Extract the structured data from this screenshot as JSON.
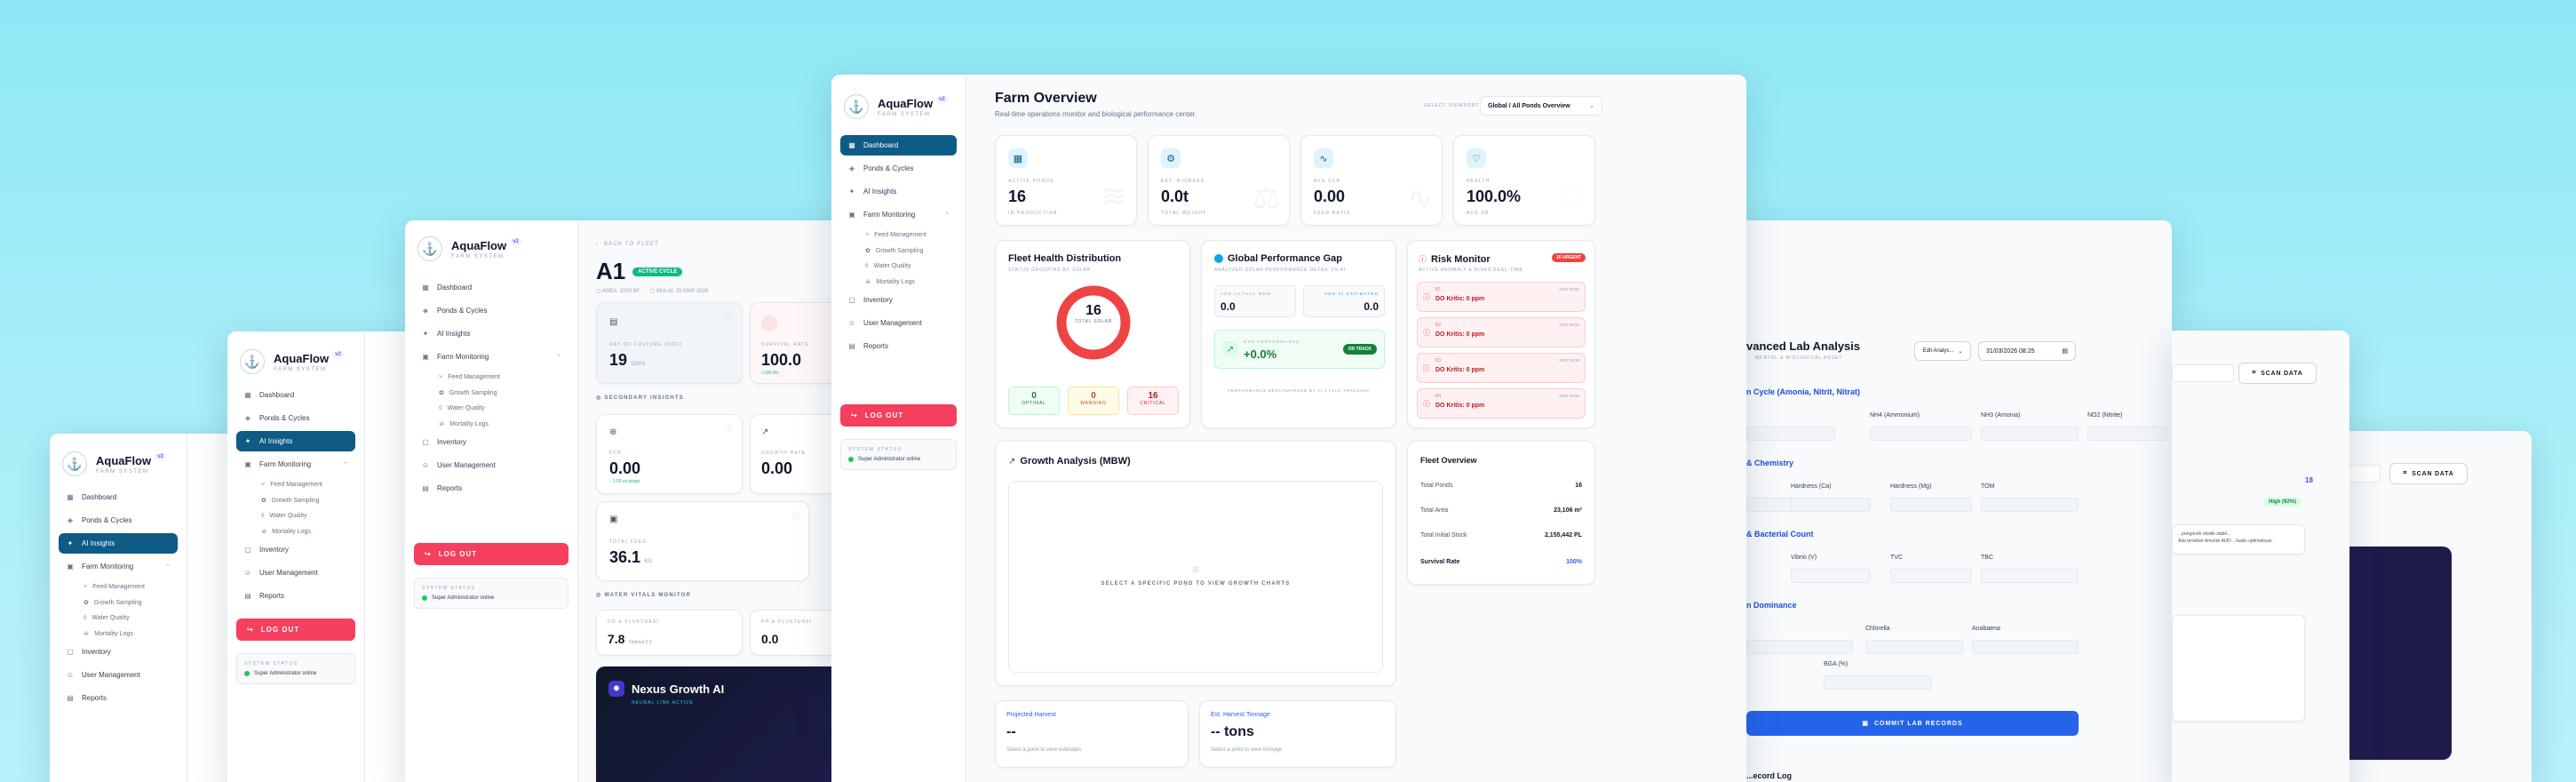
{
  "brand": {
    "name": "AquaFlow",
    "sub": "FARM SYSTEM",
    "ver": "v2"
  },
  "nav": {
    "dashboard": "Dashboard",
    "ponds": "Ponds & Cycles",
    "ai": "AI Insights",
    "farm": "Farm Monitoring",
    "feed": "Feed Management",
    "growth": "Growth Sampling",
    "water": "Water Quality",
    "mortality": "Mortality Logs",
    "inventory": "Inventory",
    "users": "User Management",
    "reports": "Reports"
  },
  "logout": "LOG OUT",
  "status": {
    "title": "SYSTEM STATUS",
    "value": "Super Administrator online"
  },
  "overview": {
    "title": "Farm Overview",
    "subtitle": "Real-time operations monitor and biological performance center.",
    "viewport_label": "SELECT VIEWPORT",
    "viewport_value": "Global / All Ponds Overview",
    "stats": [
      {
        "label": "ACTIVE PONDS",
        "value": "16",
        "note": "IN PRODUCTION"
      },
      {
        "label": "EST. BIOMASS",
        "value": "0.0t",
        "note": "TOTAL WEIGHT"
      },
      {
        "label": "AVG FCR",
        "value": "0.00",
        "note": "FEED RATIO"
      },
      {
        "label": "HEALTH",
        "value": "100.0%",
        "note": "AVG SR"
      }
    ],
    "fleet": {
      "title": "Fleet Health Distribution",
      "sub": "STATUS GROUPING BY SOLAR",
      "center": "16",
      "center_sub": "TOTAL SOLAR",
      "boxes": [
        {
          "v": "0",
          "l": "OPTIMAL"
        },
        {
          "v": "0",
          "l": "WARNING"
        },
        {
          "v": "16",
          "l": "CRITICAL"
        }
      ]
    },
    "gap": {
      "title": "Global Performance Gap",
      "sub": "ANALYZED SOLAR PERFORMANCE DETAIL VS AI",
      "actual_lbl": "ADG ACTUAL MBW",
      "actual": "0.0",
      "ai_lbl": "ADG AI ESTIMATED",
      "ai": "0.0",
      "perf_lbl": "GAP PERFORMANCE",
      "perf": "+0.0%",
      "badge": "ON TRACK",
      "foot": "PERFORMANCE BENCHMARKED BY AI CYCLE TRACKING"
    },
    "risk": {
      "title": "Risk Monitor",
      "sub": "ACTIVE ANOMALY & RISKS REAL-TIME",
      "badge": "16 URGENT",
      "rows": [
        {
          "id": "B1",
          "text": "DO Kritis: 0 ppm",
          "time": "JUST NOW"
        },
        {
          "id": "B2",
          "text": "DO Kritis: 0 ppm",
          "time": "JUST NOW"
        },
        {
          "id": "B3",
          "text": "DO Kritis: 0 ppm",
          "time": "JUST NOW"
        },
        {
          "id": "B4",
          "text": "DO Kritis: 0 ppm",
          "time": "JUST NOW"
        }
      ]
    },
    "growth": {
      "title": "Growth Analysis (MBW)",
      "placeholder": "SELECT A SPECIFIC POND TO VIEW GROWTH CHARTS"
    },
    "fleet_ov": {
      "title": "Fleet Overview",
      "rows": [
        {
          "k": "Total Ponds",
          "v": "16"
        },
        {
          "k": "Total Area",
          "v": "23,106 m²"
        },
        {
          "k": "Total Initial Stock",
          "v": "2,155,442 PL"
        },
        {
          "k": "Survival Rate",
          "v": "100%"
        }
      ]
    },
    "harvest": {
      "label": "Projected Harvest",
      "value": "--",
      "note": "Select a pond to view estimates"
    },
    "tonnage": {
      "label": "Est. Harvest Tonnage",
      "value": "-- tons",
      "note": "Select a pond to view tonnage"
    }
  },
  "pond": {
    "back": "BACK TO FLEET",
    "title": "A1",
    "badge": "ACTIVE CYCLE",
    "meta1": "AREA: 1000 M²",
    "meta2": "MULAI: 15 MAR 2026",
    "doc_lbl": "DAY OF CULTURE (DOC)",
    "doc": "19",
    "doc_unit": "DAYS",
    "surv_lbl": "SURVIVAL RATE",
    "surv": "100.0",
    "surv_note": "+100.0%",
    "secondary": "SECONDARY INSIGHTS",
    "fcr_lbl": "FCR",
    "fcr": "0.00",
    "fcr_note": "↑ 1.00 vs target",
    "growth_lbl": "GROWTH RATE",
    "growth": "0.00",
    "feed_lbl": "TOTAL FEED",
    "feed": "36.1",
    "feed_unit": "KG",
    "water": "WATER VITALS MONITOR",
    "do_lbl": "DO & FLUKTUASI",
    "do": "7.8",
    "do_note": "Optimal 5.0",
    "ph_lbl": "PH & FLUKTUASI",
    "ph": "0.0",
    "nexus": "Nexus Growth AI",
    "nexus_sub": "NEURAL LINK ACTIVE"
  },
  "lab": {
    "title": "Advanced Lab Analysis",
    "title_visible": "vanced Lab Analysis",
    "sub": "MENTAL & BIOLOGICAL ASSET",
    "edit": "Edit Analys...",
    "date": "31/03/2026 08:25",
    "sec1": "n Cycle (Amonia, Nitrit, Nitrat)",
    "nh4": "NH4 (Ammonium)",
    "nh3": "NH3 (Amonia)",
    "no2": "NO2 (Nitrite)",
    "sec2": "& Chemistry",
    "hca": "Hardness (Ca)",
    "hmg": "Hardness (Mg)",
    "tom": "TOM",
    "sec3": "& Bacterial Count",
    "vibrio": "Vibrio (V)",
    "tvc": "TVC",
    "tbc": "TBC",
    "sec4": "n Dominance",
    "chlor": "Chlorella",
    "ana": "Anabaena",
    "bga": "BGA (%)",
    "commit": "COMMIT LAB RECORDS",
    "foot": "...ecord Log"
  },
  "scan": "SCAN DATA",
  "ai_panel": {
    "count": "18",
    "badge": "High (92%)",
    "text": "...pengaruhi oksitik stabil...\nAda tersebar Amunisi AI/ID ...fasilis optimalisasi."
  }
}
